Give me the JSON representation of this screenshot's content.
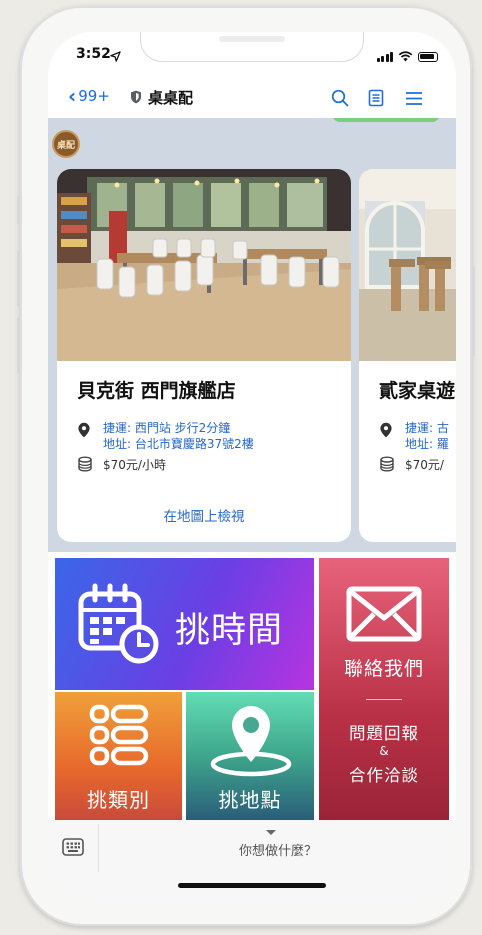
{
  "status_bar": {
    "time": "3:52"
  },
  "header": {
    "back_label": "99+",
    "title": "桌桌配",
    "icons": [
      "search-icon",
      "note-icon",
      "menu-icon"
    ]
  },
  "chat": {
    "avatar_text": "桌配",
    "cards": [
      {
        "title": "貝克街 西門旗艦店",
        "transit": "捷運: 西門站 步行2分鐘",
        "address": "地址: 台北市寶慶路37號2樓",
        "price": "$70元/小時",
        "link": "在地圖上檢視"
      },
      {
        "title": "貳家桌遊",
        "transit": "捷運: 古",
        "address": "地址: 羅",
        "price": "$70元/",
        "link": ""
      }
    ]
  },
  "rich_menu": {
    "time_label": "挑時間",
    "category_label": "挑類別",
    "place_label": "挑地點",
    "contact_label": "聯絡我們",
    "report_label": "問題回報",
    "amp": "&",
    "cooperation_label": "合作洽談"
  },
  "input_bar": {
    "menu_label": "你想做什麼？"
  },
  "colors": {
    "link_blue": "#2768c9",
    "header_blue": "#1d6ddc",
    "chat_bg": "#cfd7e3"
  }
}
